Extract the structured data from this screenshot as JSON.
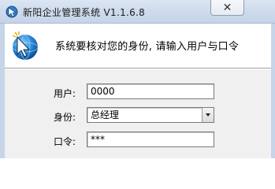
{
  "window": {
    "title": "新阳企业管理系统 V1.1.6.8",
    "close_glyph": "✕"
  },
  "header": {
    "prompt": "系统要核对您的身份, 请输入用户与口令"
  },
  "form": {
    "user_label": "用户:",
    "user_value": "0000",
    "role_label": "身份:",
    "role_value": "总经理",
    "password_label": "口令:",
    "password_value": "***"
  },
  "colors": {
    "titlebar": "#cfdcec",
    "form_background": "#f0f0f0",
    "frame": "#c6d5e8"
  },
  "icons": {
    "app": "app-cursor-icon",
    "logo": "globe-cursor-logo",
    "close": "close-icon",
    "dropdown": "chevron-down-icon"
  }
}
